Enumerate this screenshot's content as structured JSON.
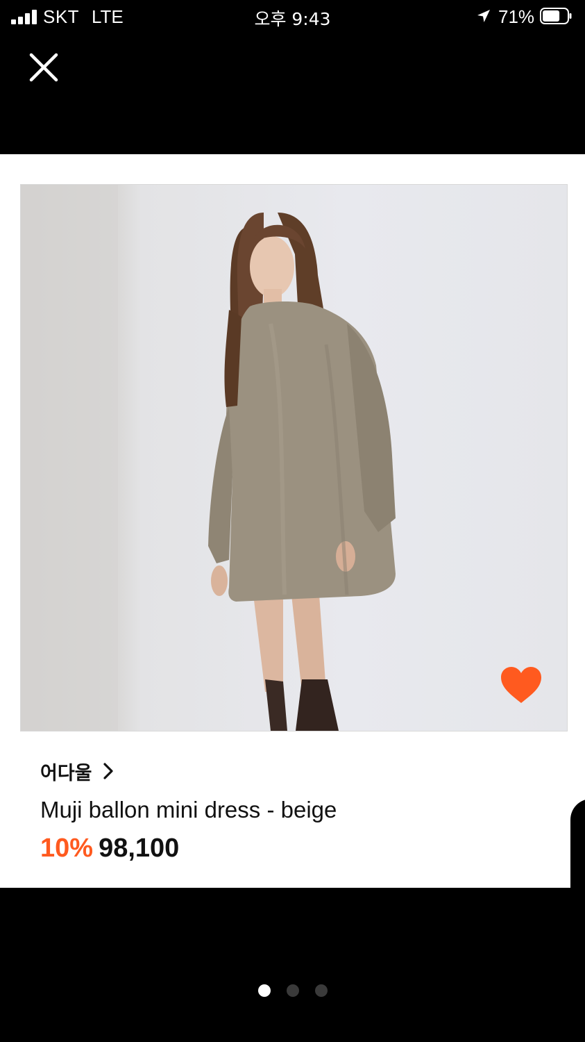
{
  "status_bar": {
    "carrier": "SKT",
    "network": "LTE",
    "time": "오후 9:43",
    "battery_percent": "71%",
    "battery_level": 0.71,
    "signal_bars": 4,
    "icons": [
      "signal-icon",
      "location-arrow-icon",
      "battery-icon"
    ]
  },
  "top_bar": {
    "close_icon": "close-icon"
  },
  "product": {
    "image_icon": "product-photo",
    "wishlisted": true,
    "heart_color": "#ff5a1f",
    "brand": "어다울",
    "name": "Muji ballon mini dress - beige",
    "discount": "10%",
    "price": "98,100"
  },
  "pagination": {
    "total": 3,
    "active_index": 0
  },
  "colors": {
    "accent": "#ff5a1f",
    "background": "#000000",
    "card": "#ffffff"
  }
}
